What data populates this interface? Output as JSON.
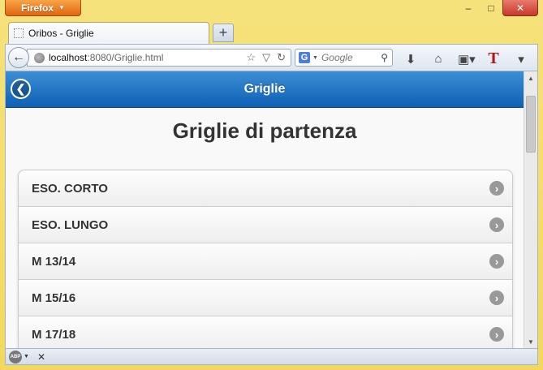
{
  "browser": {
    "app_button": "Firefox",
    "window_controls": {
      "minimize": "–",
      "maximize": "□",
      "close": "✕"
    },
    "tab": {
      "title": "Oribos - Griglie"
    },
    "new_tab": "+",
    "url": {
      "host": "localhost",
      "rest": ":8080/Griglie.html"
    },
    "search": {
      "engine": "G",
      "placeholder": "Google"
    }
  },
  "page": {
    "header": {
      "title": "Griglie"
    },
    "title": "Griglie di partenza",
    "items": [
      {
        "label": "ESO. CORTO"
      },
      {
        "label": "ESO. LUNGO"
      },
      {
        "label": "M 13/14"
      },
      {
        "label": "M 15/16"
      },
      {
        "label": "M 17/18"
      }
    ]
  },
  "colors": {
    "header_blue": "#1a6fc2",
    "accent": "#e0660f"
  }
}
